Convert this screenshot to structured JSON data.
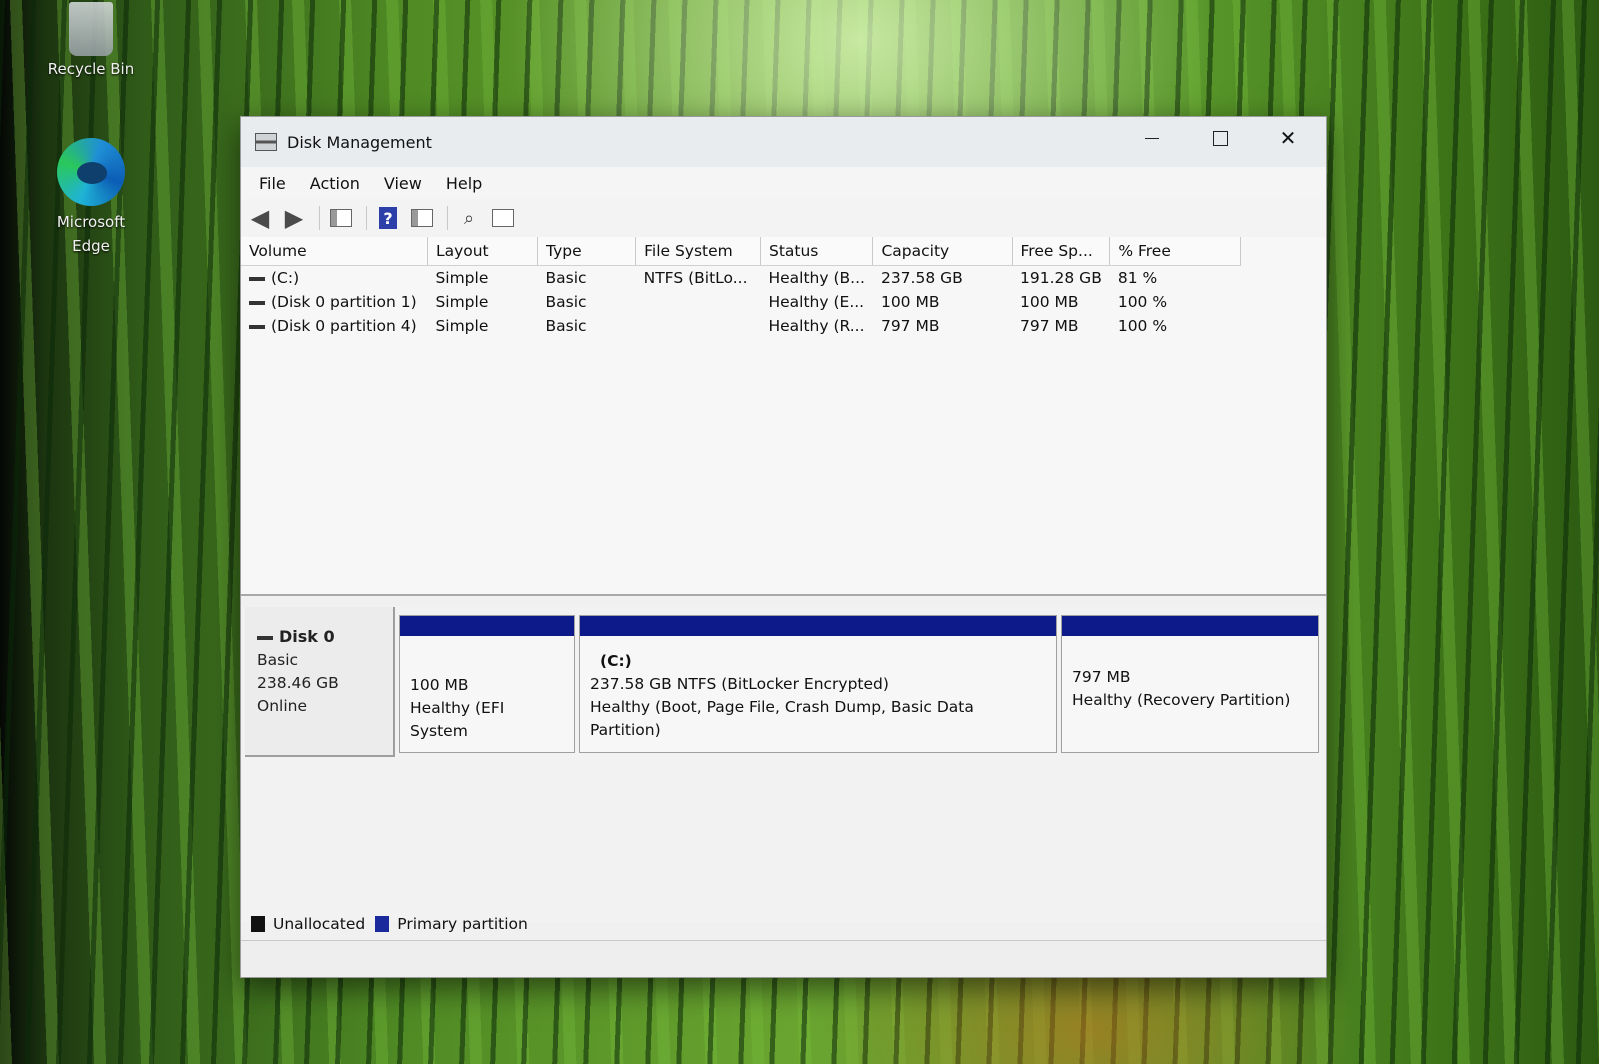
{
  "desktop": {
    "icons": [
      {
        "label": "Recycle Bin"
      },
      {
        "label": "Microsoft Edge"
      }
    ]
  },
  "window": {
    "title": "Disk Management",
    "controls": {
      "minimize": "—",
      "maximize": "☐",
      "close": "✕"
    }
  },
  "menu": {
    "items": [
      "File",
      "Action",
      "View",
      "Help"
    ]
  },
  "toolbar": {
    "icons": [
      "back-icon",
      "forward-icon",
      "show-hide-console-tree-icon",
      "help-icon",
      "show-hide-action-pane-icon",
      "connect-icon",
      "properties-icon"
    ]
  },
  "volumes": {
    "headers": [
      "Volume",
      "Layout",
      "Type",
      "File System",
      "Status",
      "Capacity",
      "Free Sp...",
      "% Free"
    ],
    "rows": [
      {
        "volume": "(C:)",
        "layout": "Simple",
        "type": "Basic",
        "file_system": "NTFS (BitLo...",
        "status": "Healthy (B...",
        "capacity": "237.58 GB",
        "free": "191.28 GB",
        "pct_free": "81 %"
      },
      {
        "volume": "(Disk 0 partition 1)",
        "layout": "Simple",
        "type": "Basic",
        "file_system": "",
        "status": "Healthy (E...",
        "capacity": "100 MB",
        "free": "100 MB",
        "pct_free": "100 %"
      },
      {
        "volume": "(Disk 0 partition 4)",
        "layout": "Simple",
        "type": "Basic",
        "file_system": "",
        "status": "Healthy (R...",
        "capacity": "797 MB",
        "free": "797 MB",
        "pct_free": "100 %"
      }
    ]
  },
  "disk": {
    "name": "Disk 0",
    "type": "Basic",
    "size": "238.46 GB",
    "state": "Online",
    "partitions": [
      {
        "title": "",
        "line1": "100 MB",
        "line2": "Healthy (EFI System"
      },
      {
        "title": "(C:)",
        "line1": "237.58 GB NTFS (BitLocker Encrypted)",
        "line2": "Healthy (Boot, Page File, Crash Dump, Basic Data Partition)"
      },
      {
        "title": "",
        "line1": "797 MB",
        "line2": "Healthy (Recovery Partition)"
      }
    ]
  },
  "legend": {
    "unallocated": "Unallocated",
    "primary": "Primary partition",
    "colors": {
      "unallocated": "#111111",
      "primary": "#1a2a9c"
    }
  }
}
